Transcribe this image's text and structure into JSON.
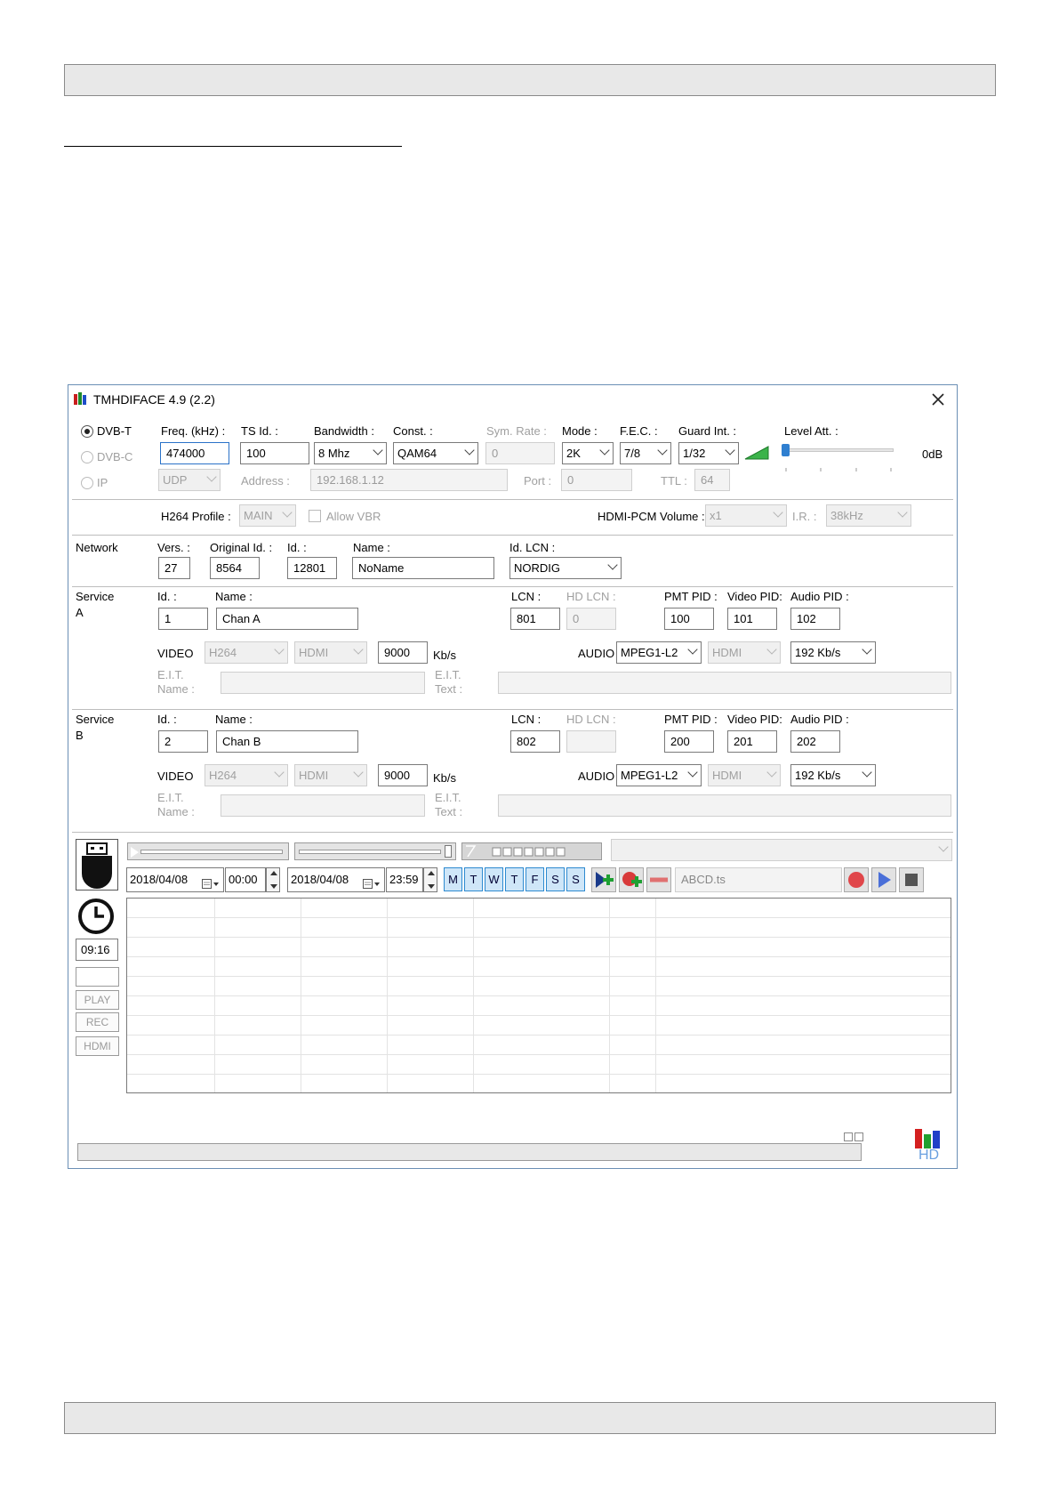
{
  "window": {
    "title": "TMHDIFACE 4.9 (2.2)"
  },
  "tuner": {
    "modes": [
      {
        "label": "DVB-T",
        "selected": true
      },
      {
        "label": "DVB-C",
        "selected": false
      },
      {
        "label": "IP",
        "selected": false
      }
    ],
    "freq_label": "Freq. (kHz) :",
    "freq_value": "474000",
    "tsid_label": "TS Id. :",
    "tsid_value": "100",
    "bandwidth_label": "Bandwidth :",
    "bandwidth_value": "8 Mhz",
    "const_label": "Const. :",
    "const_value": "QAM64",
    "symrate_label": "Sym. Rate :",
    "symrate_value": "0",
    "mode_label": "Mode :",
    "mode_value": "2K",
    "fec_label": "F.E.C. :",
    "fec_value": "7/8",
    "guard_label": "Guard Int. :",
    "guard_value": "1/32",
    "level_label": "Level Att. :",
    "level_value": "0dB",
    "protocol_value": "UDP",
    "address_label": "Address :",
    "address_value": "192.168.1.12",
    "port_label": "Port :",
    "port_value": "0",
    "ttl_label": "TTL :",
    "ttl_value": "64"
  },
  "encoding": {
    "profile_label": "H264 Profile :",
    "profile_value": "MAIN",
    "vbr_label": "Allow VBR",
    "hdmi_volume_label": "HDMI-PCM Volume :",
    "hdmi_volume_value": "x1",
    "ir_label": "I.R. :",
    "ir_value": "38kHz"
  },
  "network": {
    "section_label": "Network",
    "vers_label": "Vers. :",
    "vers_value": "27",
    "orig_label": "Original Id. :",
    "orig_value": "8564",
    "id_label": "Id. :",
    "id_value": "12801",
    "name_label": "Name :",
    "name_value": "NoName",
    "lcn_label": "Id. LCN :",
    "lcn_value": "NORDIG"
  },
  "labels": {
    "id": "Id. :",
    "name": "Name :",
    "lcn": "LCN :",
    "hdlcn": "HD LCN :",
    "pmt": "PMT PID :",
    "video_pid": "Video PID:",
    "audio_pid": "Audio PID :",
    "video": "VIDEO",
    "audio": "AUDIO",
    "kbs": "Kb/s",
    "eit_name_1": "E.I.T.",
    "eit_name_2": "Name :",
    "eit_text_1": "E.I.T.",
    "eit_text_2": "Text :"
  },
  "service_a": {
    "label_1": "Service",
    "label_2": "A",
    "id": "1",
    "name": "Chan A",
    "lcn": "801",
    "hdlcn": "0",
    "pmt": "100",
    "video_pid": "101",
    "audio_pid": "102",
    "video_codec": "H264",
    "video_source": "HDMI",
    "bitrate": "9000",
    "audio_codec": "MPEG1-L2",
    "audio_source": "HDMI",
    "audio_rate": "192 Kb/s"
  },
  "service_b": {
    "label_1": "Service",
    "label_2": "B",
    "id": "2",
    "name": "Chan B",
    "lcn": "802",
    "hdlcn": "",
    "pmt": "200",
    "video_pid": "201",
    "audio_pid": "202",
    "video_codec": "H264",
    "video_source": "HDMI",
    "bitrate": "9000",
    "audio_codec": "MPEG1-L2",
    "audio_source": "HDMI",
    "audio_rate": "192 Kb/s"
  },
  "schedule": {
    "start_date": "2018/04/08",
    "start_time": "00:00",
    "end_date": "2018/04/08",
    "end_time": "23:59",
    "days": [
      "M",
      "T",
      "W",
      "T",
      "F",
      "S",
      "S"
    ],
    "file": "ABCD.ts",
    "clock": "09:16",
    "play_label": "PLAY",
    "rec_label": "REC",
    "hdmi_label": "HDMI",
    "hd_logo": "HD",
    "accent": "#2d8ad0"
  }
}
